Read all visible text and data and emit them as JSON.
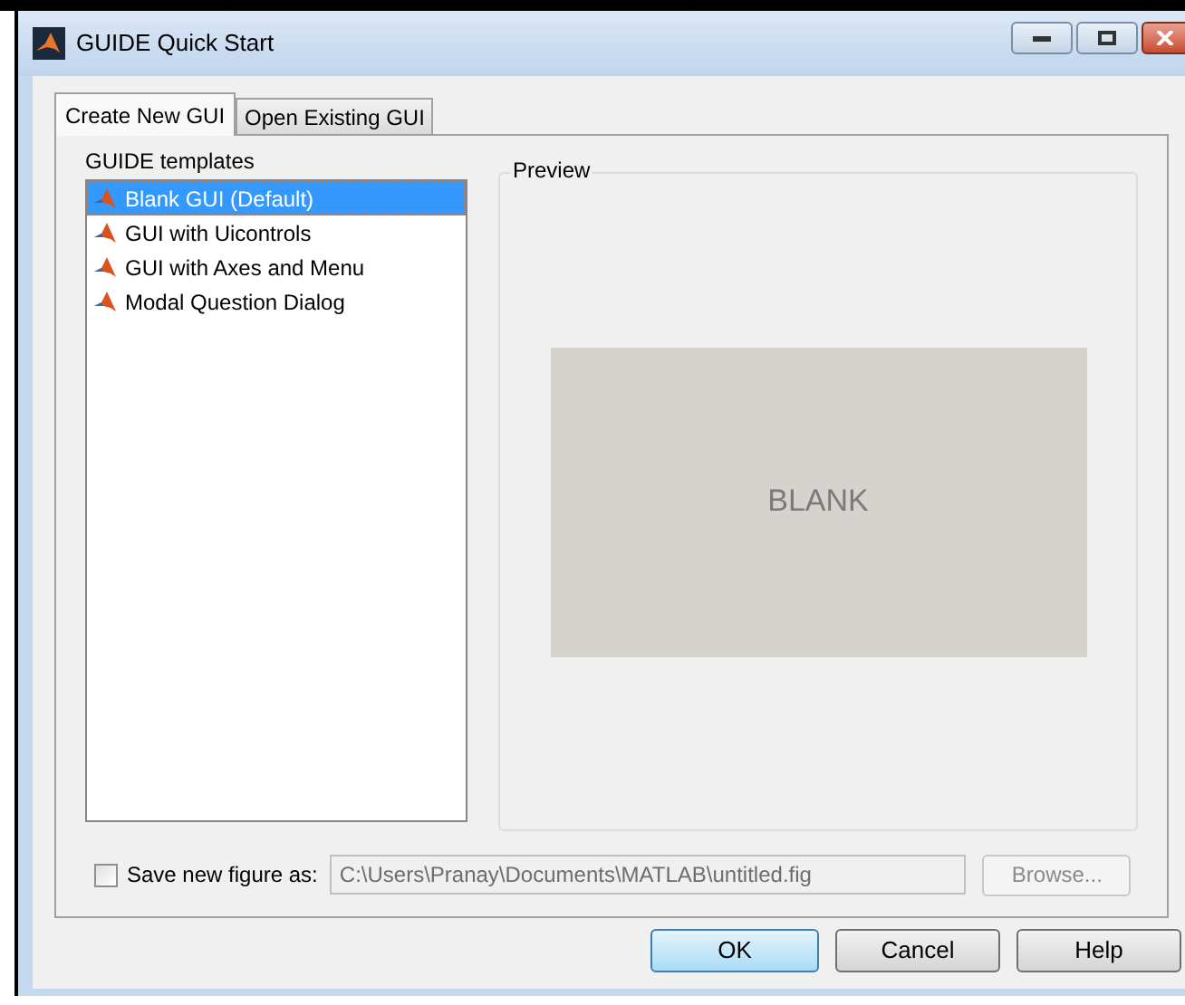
{
  "window": {
    "title": "GUIDE Quick Start"
  },
  "tabs": [
    {
      "label": "Create New GUI",
      "selected": true
    },
    {
      "label": "Open Existing GUI",
      "selected": false
    }
  ],
  "templates": {
    "label": "GUIDE templates",
    "items": [
      {
        "label": "Blank GUI (Default)",
        "selected": true
      },
      {
        "label": "GUI with Uicontrols",
        "selected": false
      },
      {
        "label": "GUI with Axes and Menu",
        "selected": false
      },
      {
        "label": "Modal Question Dialog",
        "selected": false
      }
    ]
  },
  "preview": {
    "label": "Preview",
    "image_text": "BLANK"
  },
  "save_figure": {
    "label": "Save new figure as:",
    "checked": false,
    "path": "C:\\Users\\Pranay\\Documents\\MATLAB\\untitled.fig",
    "browse": "Browse...",
    "disabled": true
  },
  "buttons": [
    {
      "label": "OK",
      "default": true
    },
    {
      "label": "Cancel",
      "default": false
    },
    {
      "label": "Help",
      "default": false
    }
  ]
}
